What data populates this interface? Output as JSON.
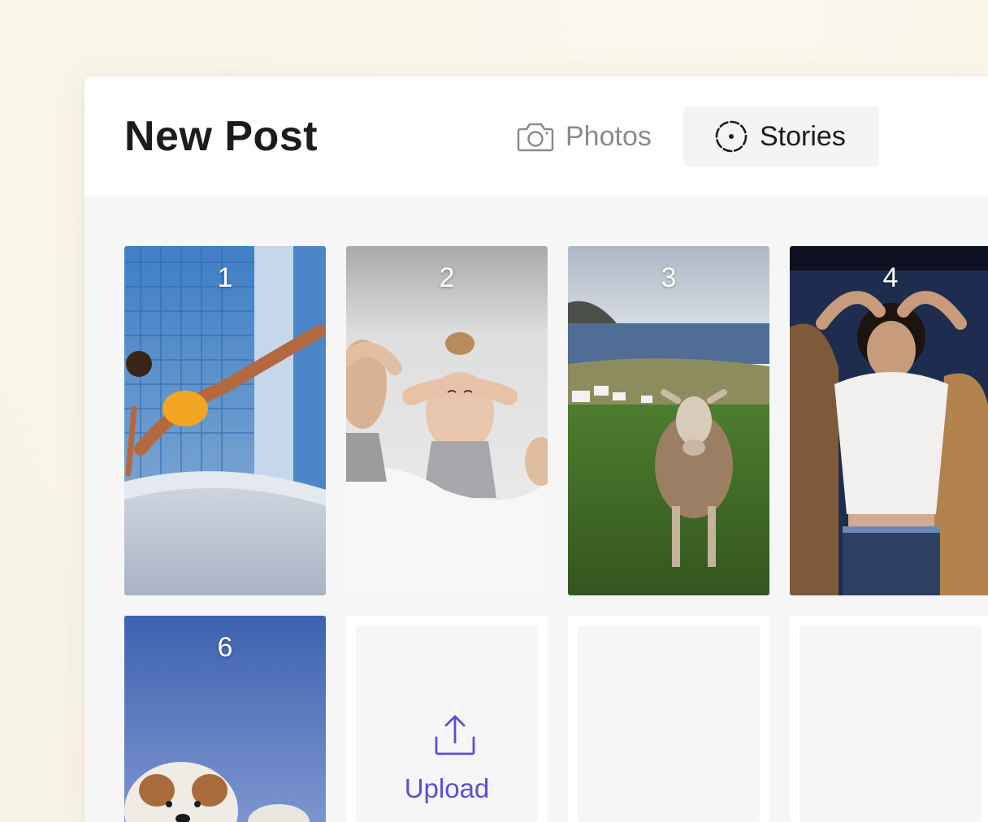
{
  "header": {
    "title": "New Post",
    "tabs": [
      {
        "label": "Photos",
        "icon": "camera-icon",
        "active": false
      },
      {
        "label": "Stories",
        "icon": "stories-icon",
        "active": true
      }
    ]
  },
  "grid": {
    "photos": [
      {
        "number": "1",
        "subject": "woman in yellow swimsuit doing plank on bridge railing"
      },
      {
        "number": "2",
        "subject": "two women lying in white bed covering eyes"
      },
      {
        "number": "3",
        "subject": "sheep standing in green coastal field"
      },
      {
        "number": "4",
        "subject": "boy lying with golden dogs"
      },
      {
        "number": "6",
        "subject": "terrier dogs under blue sky"
      }
    ],
    "upload_label": "Upload"
  },
  "colors": {
    "accent": "#5a50d4",
    "background": "#f9f6ea",
    "panel": "#f6f6f6",
    "title_text": "#1c1c1e",
    "inactive_tab": "#8a8a8e"
  }
}
